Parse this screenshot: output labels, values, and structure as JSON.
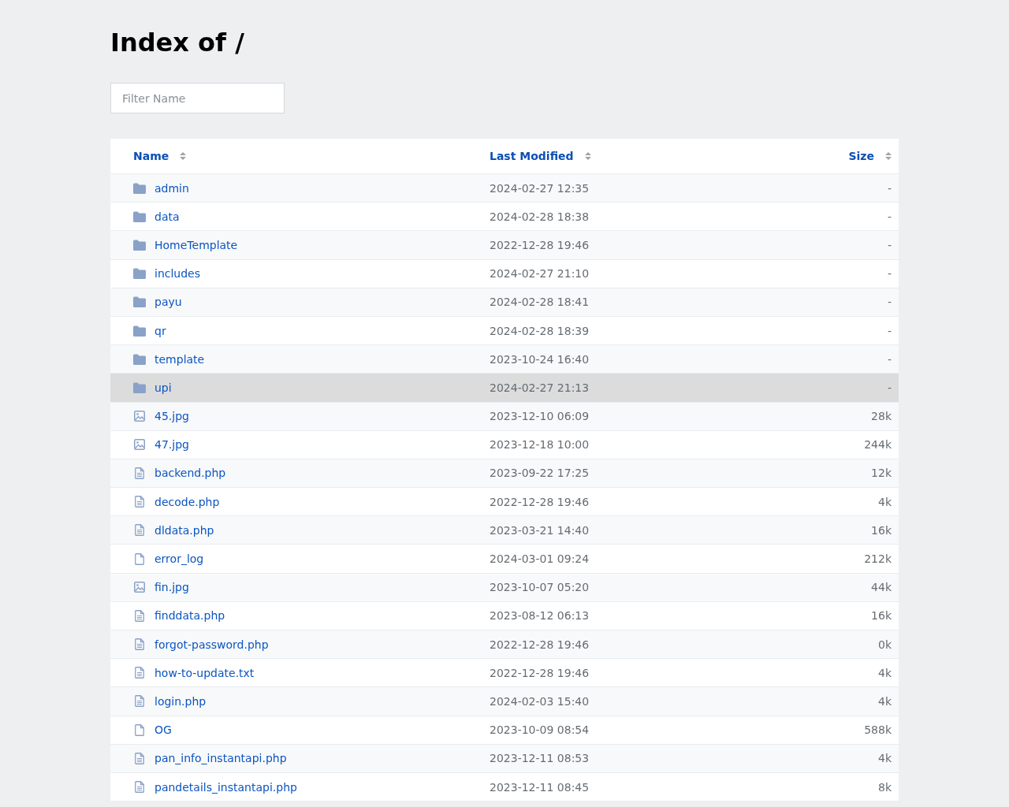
{
  "title": "Index of /",
  "filter": {
    "placeholder": "Filter Name"
  },
  "table": {
    "columns": [
      {
        "label": "Name"
      },
      {
        "label": "Last Modified"
      },
      {
        "label": "Size"
      }
    ],
    "rows": [
      {
        "kind": "folder",
        "name": "admin",
        "modified": "2024-02-27 12:35",
        "size": "-",
        "selected": false
      },
      {
        "kind": "folder",
        "name": "data",
        "modified": "2024-02-28 18:38",
        "size": "-",
        "selected": false
      },
      {
        "kind": "folder",
        "name": "HomeTemplate",
        "modified": "2022-12-28 19:46",
        "size": "-",
        "selected": false
      },
      {
        "kind": "folder",
        "name": "includes",
        "modified": "2024-02-27 21:10",
        "size": "-",
        "selected": false
      },
      {
        "kind": "folder",
        "name": "payu",
        "modified": "2024-02-28 18:41",
        "size": "-",
        "selected": false
      },
      {
        "kind": "folder",
        "name": "qr",
        "modified": "2024-02-28 18:39",
        "size": "-",
        "selected": false
      },
      {
        "kind": "folder",
        "name": "template",
        "modified": "2023-10-24 16:40",
        "size": "-",
        "selected": false
      },
      {
        "kind": "folder",
        "name": "upi",
        "modified": "2024-02-27 21:13",
        "size": "-",
        "selected": true
      },
      {
        "kind": "image",
        "name": "45.jpg",
        "modified": "2023-12-10 06:09",
        "size": "28k",
        "selected": false
      },
      {
        "kind": "image",
        "name": "47.jpg",
        "modified": "2023-12-18 10:00",
        "size": "244k",
        "selected": false
      },
      {
        "kind": "text",
        "name": "backend.php",
        "modified": "2023-09-22 17:25",
        "size": "12k",
        "selected": false
      },
      {
        "kind": "text",
        "name": "decode.php",
        "modified": "2022-12-28 19:46",
        "size": "4k",
        "selected": false
      },
      {
        "kind": "text",
        "name": "dldata.php",
        "modified": "2023-03-21 14:40",
        "size": "16k",
        "selected": false
      },
      {
        "kind": "file",
        "name": "error_log",
        "modified": "2024-03-01 09:24",
        "size": "212k",
        "selected": false
      },
      {
        "kind": "image",
        "name": "fin.jpg",
        "modified": "2023-10-07 05:20",
        "size": "44k",
        "selected": false
      },
      {
        "kind": "text",
        "name": "finddata.php",
        "modified": "2023-08-12 06:13",
        "size": "16k",
        "selected": false
      },
      {
        "kind": "text",
        "name": "forgot-password.php",
        "modified": "2022-12-28 19:46",
        "size": "0k",
        "selected": false
      },
      {
        "kind": "text",
        "name": "how-to-update.txt",
        "modified": "2022-12-28 19:46",
        "size": "4k",
        "selected": false
      },
      {
        "kind": "text",
        "name": "login.php",
        "modified": "2024-02-03 15:40",
        "size": "4k",
        "selected": false
      },
      {
        "kind": "file",
        "name": "OG",
        "modified": "2023-10-09 08:54",
        "size": "588k",
        "selected": false
      },
      {
        "kind": "text",
        "name": "pan_info_instantapi.php",
        "modified": "2023-12-11 08:53",
        "size": "4k",
        "selected": false
      },
      {
        "kind": "text",
        "name": "pandetails_instantapi.php",
        "modified": "2023-12-11 08:45",
        "size": "8k",
        "selected": false
      }
    ]
  }
}
